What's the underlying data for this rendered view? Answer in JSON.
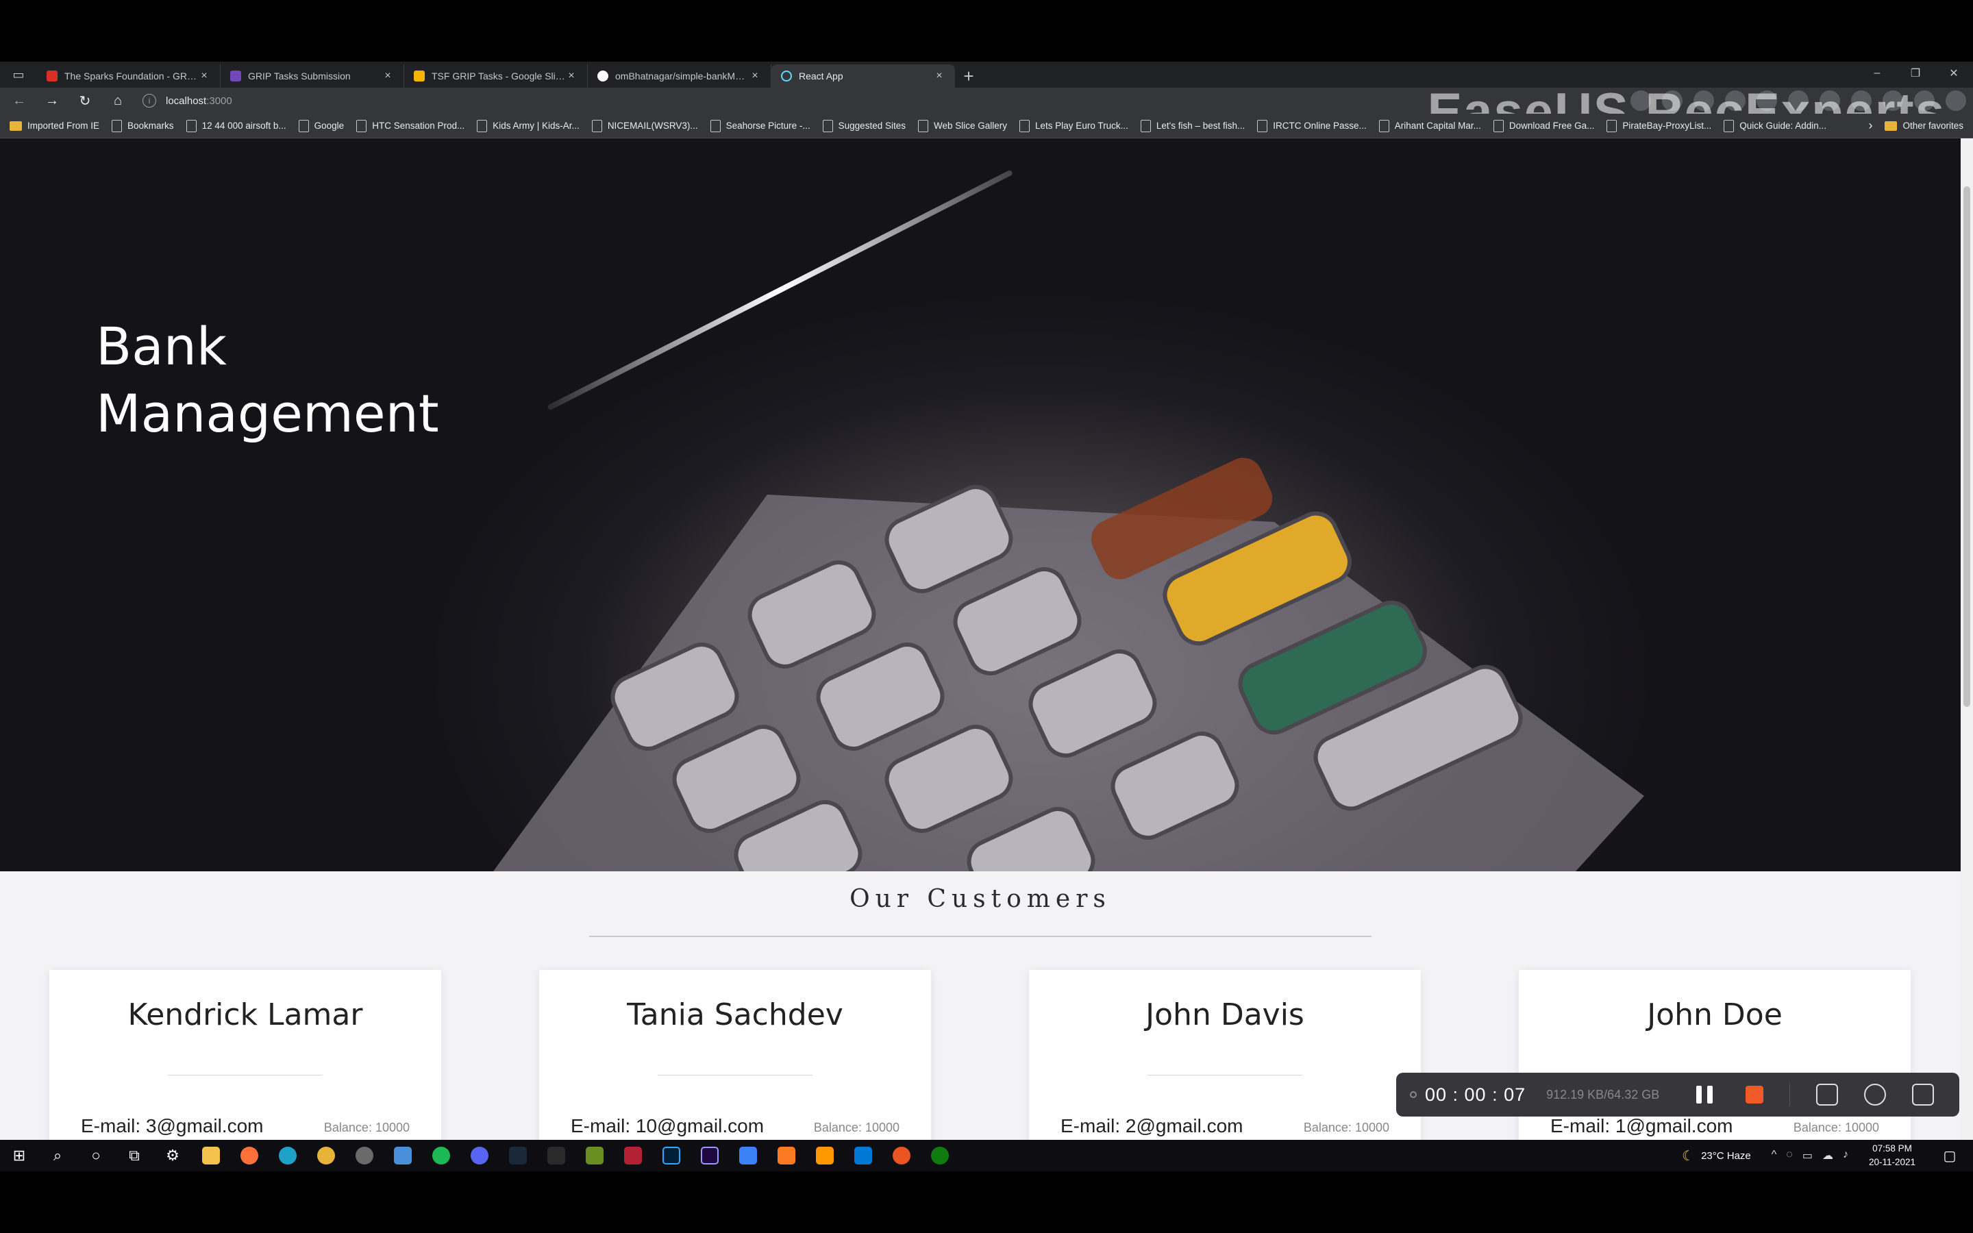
{
  "browser": {
    "tabs": [
      {
        "title": "The Sparks Foundation - GRIP Si",
        "favicon_color": "#d93025",
        "icon": "gmail-icon"
      },
      {
        "title": "GRIP Tasks Submission",
        "favicon_color": "#7248b9",
        "icon": "forms-icon"
      },
      {
        "title": "TSF GRIP Tasks - Google Slides",
        "favicon_color": "#f4b400",
        "icon": "slides-icon"
      },
      {
        "title": "omBhatnagar/simple-bankMana",
        "favicon_color": "#ffffff",
        "icon": "github-icon"
      },
      {
        "title": "React App",
        "favicon_color": "#61dafb",
        "icon": "react-icon"
      }
    ],
    "url_host": "localhost",
    "url_port": ":3000",
    "watermark": "EaseUS RecExperts",
    "bookmarks": [
      "Imported From IE",
      "Bookmarks",
      "12 44 000 airsoft b...",
      "Google",
      "HTC Sensation Prod...",
      "Kids Army | Kids-Ar...",
      "NICEMAIL(WSRV3)...",
      "Seahorse Picture -...",
      "Suggested Sites",
      "Web Slice Gallery",
      "Lets Play Euro Truck...",
      "Let's fish – best fish...",
      "IRCTC Online Passe...",
      "Arihant Capital Mar...",
      "Download Free Ga...",
      "PirateBay-ProxyList...",
      "Quick Guide: Addin..."
    ],
    "other_favorites": "Other favorites"
  },
  "page": {
    "hero_title_line1": "Bank",
    "hero_title_line2": "Management",
    "section_title": "Our Customers",
    "customers": [
      {
        "name": "Kendrick Lamar",
        "email": "E-mail: 3@gmail.com",
        "balance": "Balance: 10000"
      },
      {
        "name": "Tania Sachdev",
        "email": "E-mail: 10@gmail.com",
        "balance": "Balance: 10000"
      },
      {
        "name": "John Davis",
        "email": "E-mail: 2@gmail.com",
        "balance": "Balance: 10000"
      },
      {
        "name": "John Doe",
        "email": "E-mail: 1@gmail.com",
        "balance": "Balance: 10000"
      }
    ]
  },
  "recorder": {
    "time": "00 : 00 : 07",
    "size": "912.19 KB/64.32 GB"
  },
  "taskbar": {
    "weather": "23°C  Haze",
    "time": "07:58 PM",
    "date": "20-11-2021"
  }
}
